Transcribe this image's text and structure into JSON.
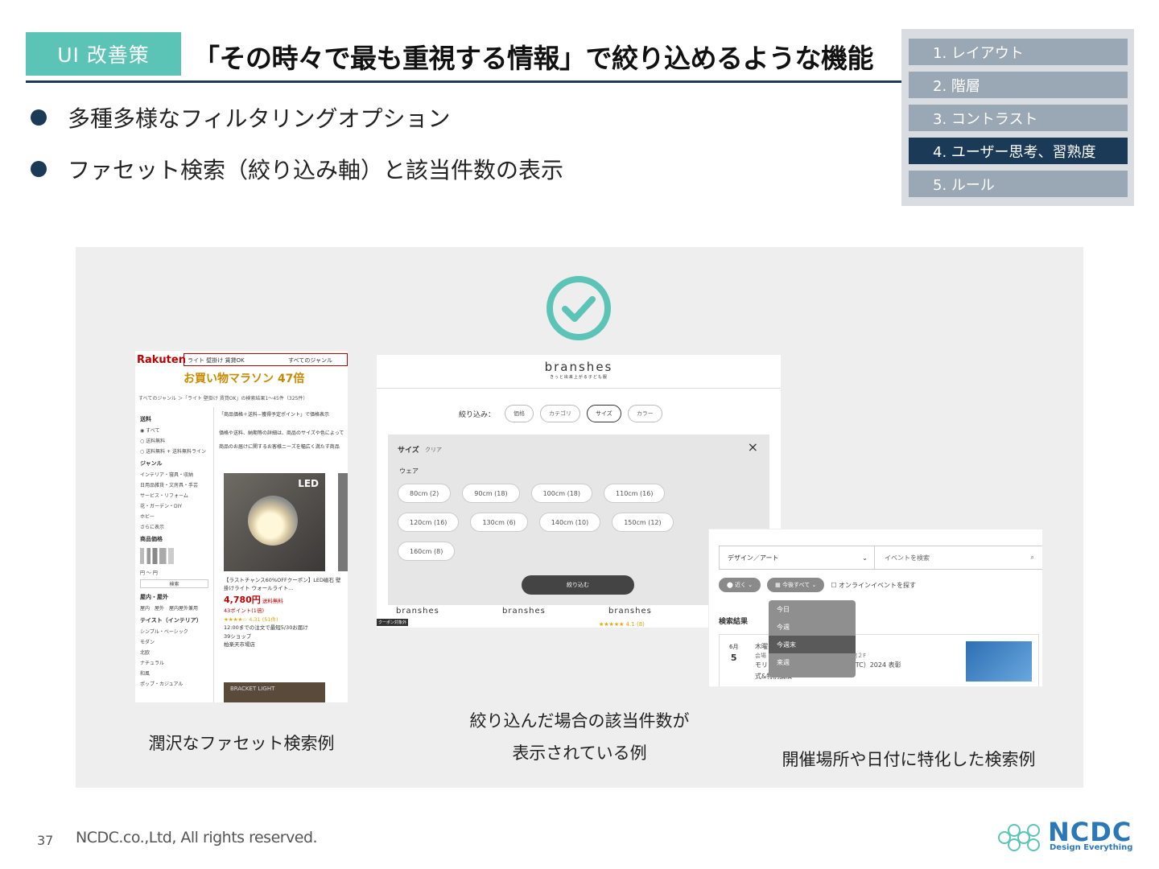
{
  "header": {
    "tag": "UI 改善策",
    "title": "「その時々で最も重視する情報」で絞り込めるような機能"
  },
  "bullets": [
    "多種多様なフィルタリングオプション",
    "ファセット検索（絞り込み軸）と該当件数の表示"
  ],
  "nav": {
    "items": [
      "1. レイアウト",
      "2. 階層",
      "3. コントラスト",
      "4. ユーザー思考、習熟度",
      "5. ルール"
    ]
  },
  "example1": {
    "logo": "Rakuten",
    "search": "ライト 壁掛け 賃貸OK",
    "search_genre": "すべてのジャンル",
    "banner": "お買い物マラソン 47倍",
    "crumb": "すべてのジャンル ＞「ライト 壁掛け 賃貸OK」の検索結果1〜45件（325件）",
    "side": {
      "h1": "送料",
      "i1": "◉ すべて",
      "i2": "○ 送料無料",
      "i3": "○ 送料無料 + 送料無料ライン",
      "h2": "ジャンル",
      "g1": "インテリア・寝具・収納",
      "g2": "日用品雑貨・文房具・手芸",
      "g3": "サービス・リフォーム",
      "g4": "花・ガーデン・DIY",
      "g5": "ホビー",
      "g6": "さらに表示",
      "h3": "商品価格",
      "range": "円 〜 円",
      "btn": "検索",
      "h4": "屋内・屋外",
      "io": "屋内　屋外　屋内屋外兼用",
      "h5": "テイスト（インテリア）",
      "t1": "シンプル・ベーシック",
      "t2": "モダン",
      "t3": "北欧",
      "t4": "ナチュラル",
      "t5": "和風",
      "t6": "ポップ・カジュアル"
    },
    "note1": "「商品価格＋送料−獲得予定ポイント」で価格表示",
    "note2": "価格や送料、納期等の詳細は、商品のサイズや色によって",
    "note3": "商品のお届けに関するお客様ニーズを幅広く満たす商品",
    "led": "LED",
    "ptitle": "【ラストチャンス60%OFFクーポン】LED磁石 壁掛けライト ウォールライト…",
    "price": "4,780円",
    "price_note": "送料無料",
    "points": "43ポイント(1倍)",
    "rating": "★★★★☆ 4.31 (51件)",
    "ship": "12:00までの注文で最短5/30お届け",
    "shop": "39ショップ",
    "store": "柏楽天市場店",
    "bracket": "BRACKET LIGHT"
  },
  "example2": {
    "brand": "branshes",
    "sub": "きっと出来上がる子ども服",
    "filter_label": "絞り込み：",
    "pills": [
      "価格",
      "カテゴリ",
      "サイズ",
      "カラー"
    ],
    "modal_title": "サイズ",
    "modal_clear": "クリア",
    "modal_close": "×",
    "modal_cat": "ウェア",
    "chips": [
      "80cm (2)",
      "90cm (18)",
      "100cm (18)",
      "110cm (16)",
      "120cm (16)",
      "130cm (6)",
      "140cm (10)",
      "150cm (12)",
      "160cm (8)"
    ],
    "apply": "絞り込む",
    "bottom": [
      "branshes",
      "branshes",
      "branshes"
    ],
    "coupon": "クーポン対象外",
    "stars": "★★★★★ 4.1 (8)"
  },
  "example3": {
    "category": "デザイン／アート",
    "query": "イベントを検索",
    "near": "近く",
    "date": "今後すべて",
    "online": "オンラインイベントを探す",
    "results": "検索結果",
    "month": "6月",
    "day": "5",
    "line1": "木曜日",
    "line2": "会場　丁目１６−２ 神田明神文化交流館２F",
    "line3": "モリ　　　　　　ティション（MOTC）2024 表彰",
    "line4": "式&特別講演",
    "menu": [
      "今日",
      "今週",
      "今週末",
      "来週"
    ]
  },
  "captions": {
    "c1": "潤沢なファセット検索例",
    "c2a": "絞り込んだ場合の該当件数が",
    "c2b": "表示されている例",
    "c3": "開催場所や日付に特化した検索例"
  },
  "footer": {
    "page": "37",
    "copyright": "NCDC.co.,Ltd, All rights reserved.",
    "logo": "NCDC",
    "tagline": "Design Everything"
  },
  "colors": {
    "accent": "#5cc4b7",
    "navy": "#1b3a57",
    "nav_inactive": "#9aa7b4",
    "brand_blue": "#2a78b8"
  }
}
